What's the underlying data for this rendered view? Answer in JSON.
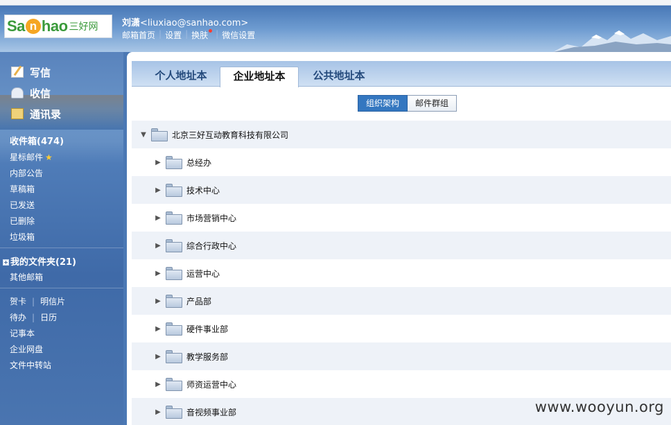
{
  "header": {
    "logo_prefix": "Sa",
    "logo_n": "n",
    "logo_suffix": "hao",
    "logo_cn": "三好网",
    "user_name": "刘潇",
    "user_email": "<liuxiao@sanhao.com>",
    "links": [
      "邮箱首页",
      "设置",
      "换肤",
      "微信设置"
    ]
  },
  "sidebar": {
    "main": [
      {
        "label": "写信",
        "icon": "pencil-icon"
      },
      {
        "label": "收信",
        "icon": "inbox-icon"
      },
      {
        "label": "通讯录",
        "icon": "contacts-icon"
      }
    ],
    "inbox": "收件箱(474)",
    "folders": [
      "星标邮件",
      "内部公告",
      "草稿箱",
      "已发送",
      "已删除",
      "垃圾箱"
    ],
    "my_folders": "我的文件夹(21)",
    "other_mail": "其他邮箱",
    "tools_row1": [
      "贺卡",
      "明信片"
    ],
    "tools_row2": [
      "待办",
      "日历"
    ],
    "tools": [
      "记事本",
      "企业网盘",
      "文件中转站"
    ]
  },
  "tabs": [
    "个人地址本",
    "企业地址本",
    "公共地址本"
  ],
  "active_tab": "企业地址本",
  "segments": [
    "组织架构",
    "邮件群组"
  ],
  "tree": {
    "root": "北京三好互动教育科技有限公司",
    "children": [
      "总经办",
      "技术中心",
      "市场营销中心",
      "综合行政中心",
      "运营中心",
      "产品部",
      "硬件事业部",
      "教学服务部",
      "师资运营中心",
      "音视频事业部"
    ]
  },
  "watermark": "www.wooyun.org",
  "colors": {
    "header_blue": "#3f6fb0",
    "active_segment": "#3477c0",
    "row_alt": "#eef2f8",
    "notify_dot": "#ff3b2f"
  }
}
